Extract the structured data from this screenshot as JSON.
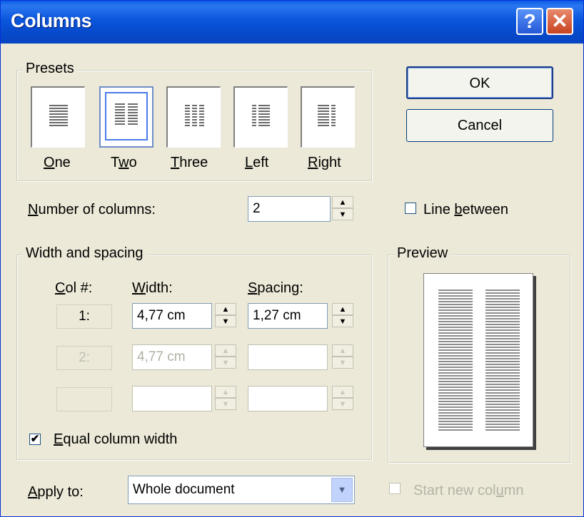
{
  "window": {
    "title": "Columns"
  },
  "presets": {
    "label": "Presets",
    "items": [
      {
        "label": "One",
        "mnemonic": "O",
        "rest": "ne"
      },
      {
        "label": "Two",
        "mnemonic": "w",
        "pre": "T",
        "rest": "o"
      },
      {
        "label": "Three",
        "mnemonic": "T",
        "rest": "hree"
      },
      {
        "label": "Left",
        "mnemonic": "L",
        "rest": "eft"
      },
      {
        "label": "Right",
        "mnemonic": "R",
        "rest": "ight"
      }
    ],
    "selected": "Two"
  },
  "buttons": {
    "ok": "OK",
    "cancel": "Cancel"
  },
  "number_of_columns": {
    "label_pre": "N",
    "label_rest": "umber of columns:",
    "value": "2"
  },
  "line_between": {
    "label_pre": "Line ",
    "label_mn": "b",
    "label_rest": "etween",
    "checked": false
  },
  "width_spacing": {
    "label": "Width and spacing",
    "col_header_mn": "C",
    "col_header_rest": "ol #:",
    "width_header_mn": "W",
    "width_header_rest": "idth:",
    "spacing_header_mn": "S",
    "spacing_header_rest": "pacing:",
    "rows": [
      {
        "col": "1:",
        "width": "4,77 cm",
        "spacing": "1,27 cm",
        "enabled": true
      },
      {
        "col": "2:",
        "width": "4,77 cm",
        "spacing": "",
        "enabled": false
      },
      {
        "col": "",
        "width": "",
        "spacing": "",
        "enabled": false
      }
    ]
  },
  "equal_width": {
    "label_mn": "E",
    "label_rest": "qual column width",
    "checked": true
  },
  "preview": {
    "label": "Preview"
  },
  "apply_to": {
    "label_mn": "A",
    "label_rest": "pply to:",
    "value": "Whole document"
  },
  "start_new_column": {
    "label_pre": "Start new col",
    "label_mn": "u",
    "label_rest": "mn",
    "checked": false,
    "enabled": false
  }
}
